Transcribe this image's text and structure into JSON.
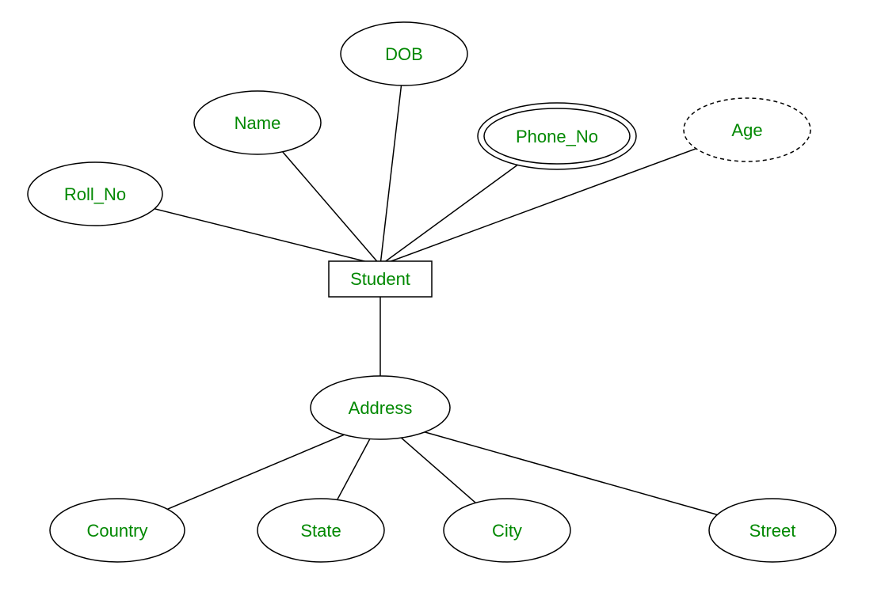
{
  "entity": {
    "student": "Student"
  },
  "attributes": {
    "roll_no": "Roll_No",
    "name": "Name",
    "dob": "DOB",
    "phone_no": "Phone_No",
    "age": "Age",
    "address": "Address",
    "country": "Country",
    "state": "State",
    "city": "City",
    "street": "Street"
  },
  "diagram": {
    "type": "ER",
    "notes": {
      "phone_no": "multivalued (double ellipse)",
      "age": "derived (dashed ellipse)",
      "address": "composite attribute"
    }
  }
}
